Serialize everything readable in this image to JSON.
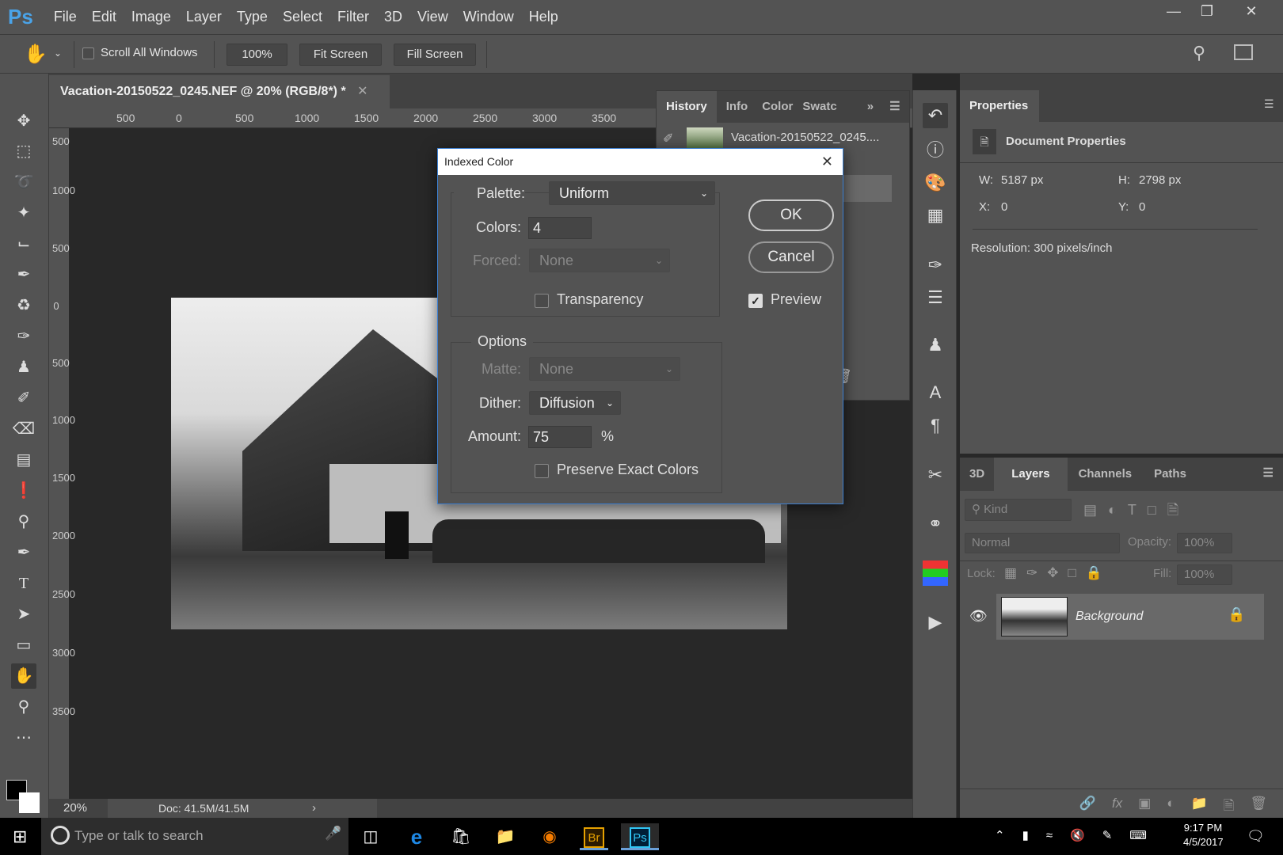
{
  "app": {
    "logo": "Ps",
    "menu": [
      "File",
      "Edit",
      "Image",
      "Layer",
      "Type",
      "Select",
      "Filter",
      "3D",
      "View",
      "Window",
      "Help"
    ]
  },
  "options": {
    "tool": "hand-icon",
    "scroll_all_windows": "Scroll All Windows",
    "scroll_all_checked": false,
    "zoom_100": "100%",
    "fit_screen": "Fit Screen",
    "fill_screen": "Fill Screen"
  },
  "document": {
    "tab_title": "Vacation-20150522_0245.NEF @ 20% (RGB/8*) *",
    "zoom": "20%",
    "doc_size": "Doc: 41.5M/41.5M"
  },
  "rulers": {
    "horizontal": [
      "500",
      "0",
      "500",
      "1000",
      "1500",
      "2000",
      "2500",
      "3000",
      "3500"
    ],
    "vertical": [
      "500",
      "0",
      "1000",
      "500",
      "0",
      "500",
      "1000",
      "1500",
      "2000",
      "2500",
      "3000",
      "3500"
    ]
  },
  "history": {
    "tabs": [
      "History",
      "Info",
      "Color",
      "Swatc"
    ],
    "active": "History",
    "snapshot": "Vacation-20150522_0245...."
  },
  "properties": {
    "tab": "Properties",
    "heading": "Document Properties",
    "w_label": "W:",
    "w": "5187 px",
    "h_label": "H:",
    "h": "2798 px",
    "x_label": "X:",
    "x": "0",
    "y_label": "Y:",
    "y": "0",
    "resolution": "Resolution: 300 pixels/inch"
  },
  "layers": {
    "tabs": [
      "3D",
      "Layers",
      "Channels",
      "Paths"
    ],
    "active": "Layers",
    "filter": "Kind",
    "blend": "Normal",
    "opacity_label": "Opacity:",
    "opacity": "100%",
    "lock_label": "Lock:",
    "fill_label": "Fill:",
    "fill": "100%",
    "items": [
      {
        "name": "Background",
        "visible": true,
        "locked": true
      }
    ]
  },
  "dialog": {
    "title": "Indexed Color",
    "palette_label": "Palette:",
    "palette": "Uniform",
    "colors_label": "Colors:",
    "colors": "4",
    "forced_label": "Forced:",
    "forced": "None",
    "transparency": "Transparency",
    "transparency_checked": false,
    "options_label": "Options",
    "matte_label": "Matte:",
    "matte": "None",
    "dither_label": "Dither:",
    "dither": "Diffusion",
    "amount_label": "Amount:",
    "amount": "75",
    "percent": "%",
    "preserve": "Preserve Exact Colors",
    "preserve_checked": false,
    "ok": "OK",
    "cancel": "Cancel",
    "preview": "Preview",
    "preview_checked": true
  },
  "taskbar": {
    "search_placeholder": "Type or talk to search",
    "time": "9:17 PM",
    "date": "4/5/2017",
    "apps": [
      "Task View",
      "Edge",
      "Store",
      "File Explorer",
      "Firefox",
      "Br",
      "Ps"
    ]
  }
}
